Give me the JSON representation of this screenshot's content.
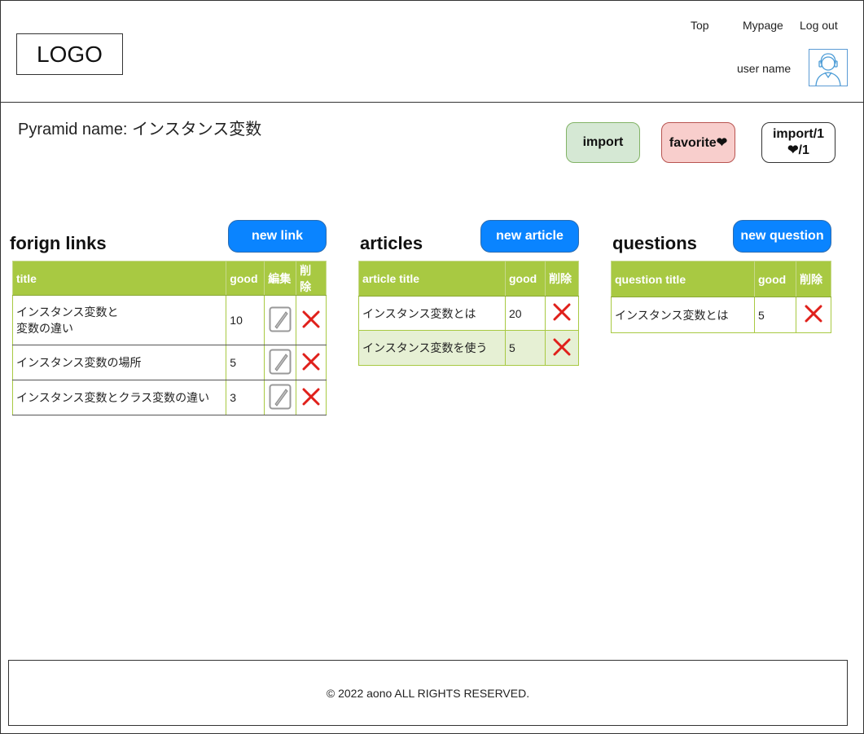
{
  "header": {
    "logo": "LOGO",
    "nav": {
      "top": "Top",
      "mypage": "Mypage",
      "logout": "Log out"
    },
    "user_name": "user name"
  },
  "pyramid": {
    "label": "Pyramid name:",
    "name": "インスタンス変数"
  },
  "buttons": {
    "import": "import",
    "favorite": "favorite❤",
    "import_count": "import/1",
    "favorite_count": "❤/1"
  },
  "links": {
    "title": "forign links",
    "new_button": "new link",
    "headers": [
      "title",
      "good",
      "編集",
      "削除"
    ],
    "rows": [
      {
        "title_line1": "インスタンス変数と",
        "title_line2": "変数の違い",
        "good": "10"
      },
      {
        "title_line1": "インスタンス変数の場所",
        "good": "5"
      },
      {
        "title_line1": "インスタンス変数とクラス変数の違い",
        "good": "3"
      }
    ]
  },
  "articles": {
    "title": "articles",
    "new_button": "new article",
    "headers": [
      "article title",
      "good",
      "削除"
    ],
    "rows": [
      {
        "title": "インスタンス変数とは",
        "good": "20"
      },
      {
        "title": "インスタンス変数を使う",
        "good": "5"
      }
    ]
  },
  "questions": {
    "title": "questions",
    "new_button": "new question",
    "headers": [
      "question title",
      "good",
      "削除"
    ],
    "rows": [
      {
        "title": "インスタンス変数とは",
        "good": "5"
      }
    ]
  },
  "footer": {
    "copyright": "© 2022 aono ALL RIGHTS RESERVED."
  },
  "colors": {
    "header_green": "#a8c942",
    "new_button_blue": "#0a84ff",
    "import_bg": "#d5e8d4",
    "favorite_bg": "#f8cecc",
    "delete_red": "#e0201b"
  },
  "icons": {
    "avatar": "user-avatar-icon",
    "edit": "pencil-icon",
    "delete": "x-icon"
  }
}
